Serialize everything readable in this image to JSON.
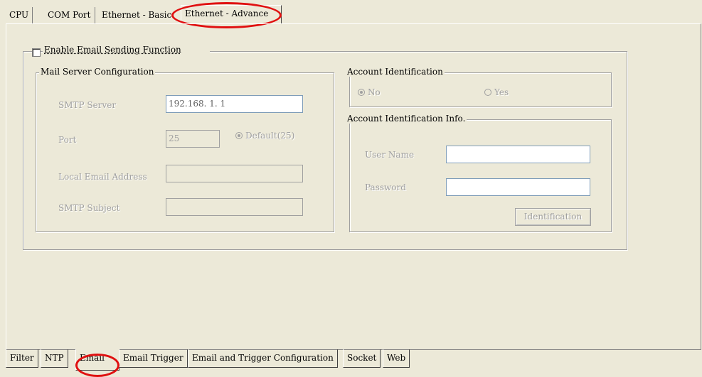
{
  "top_tabs": [
    "CPU",
    "COM Port",
    "Ethernet - Basic",
    "Ethernet - Advance"
  ],
  "active_top_tab": "Ethernet - Advance",
  "enable_email": {
    "label": "Enable Email Sending Function",
    "checked": false
  },
  "mail_server": {
    "title": "Mail Server Configuration",
    "smtp_server_label": "SMTP Server",
    "smtp_server_value": "192.168. 1. 1",
    "port_label": "Port",
    "port_value": "25",
    "default_label": "Default(25)",
    "local_email_label": "Local Email Address",
    "local_email_value": "",
    "smtp_subject_label": "SMTP Subject",
    "smtp_subject_value": ""
  },
  "account_identification": {
    "title": "Account Identification",
    "no_label": "No",
    "yes_label": "Yes",
    "selected": "No"
  },
  "account_info": {
    "title": "Account Identification Info.",
    "username_label": "User Name",
    "username_value": "",
    "password_label": "Password",
    "password_value": "",
    "identification_button": "Identification"
  },
  "bottom_tabs": [
    "Filter",
    "NTP",
    "Email",
    "Email Trigger",
    "Email and Trigger Configuration",
    "Socket",
    "Web"
  ],
  "active_bottom_tab": "Email",
  "highlight_color": "#e01010"
}
